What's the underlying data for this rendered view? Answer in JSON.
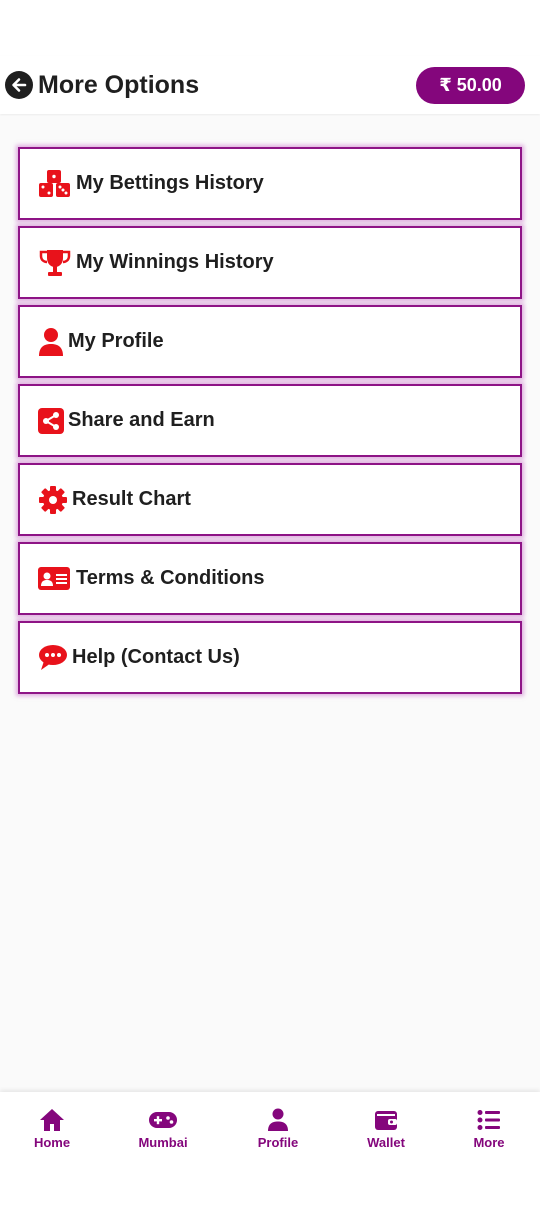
{
  "header": {
    "title": "More Options",
    "balance": "₹ 50.00"
  },
  "menu": [
    {
      "label": "My Bettings History",
      "icon": "dice-icon"
    },
    {
      "label": "My Winnings History",
      "icon": "trophy-icon"
    },
    {
      "label": "My Profile",
      "icon": "user-icon"
    },
    {
      "label": "Share and Earn",
      "icon": "share-icon"
    },
    {
      "label": "Result Chart",
      "icon": "gear-icon"
    },
    {
      "label": "Terms & Conditions",
      "icon": "id-card-icon"
    },
    {
      "label": "Help (Contact Us)",
      "icon": "chat-bubble-icon"
    }
  ],
  "bottom_nav": [
    {
      "label": "Home",
      "icon": "home-icon"
    },
    {
      "label": "Mumbai",
      "icon": "gamepad-icon"
    },
    {
      "label": "Profile",
      "icon": "user-icon"
    },
    {
      "label": "Wallet",
      "icon": "wallet-icon"
    },
    {
      "label": "More",
      "icon": "list-icon"
    }
  ],
  "colors": {
    "accent": "#84067c",
    "icon_red": "#e8121b",
    "text": "#1f1f1f"
  }
}
